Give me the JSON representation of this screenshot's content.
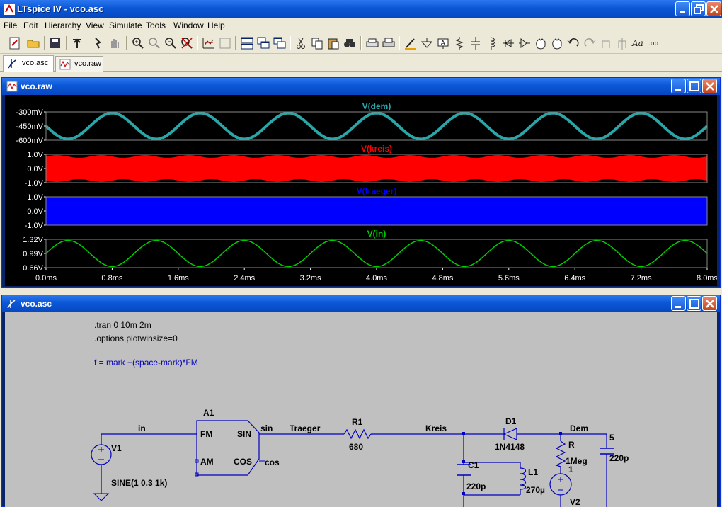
{
  "app": {
    "title": "LTspice IV - vco.asc"
  },
  "menu": [
    "File",
    "Edit",
    "Hierarchy",
    "View",
    "Simulate",
    "Tools",
    "Window",
    "Help"
  ],
  "toolbar_icons": [
    "run-icon",
    "open-icon",
    "save-icon",
    "control-panel-icon",
    "run-sim-icon",
    "halt-icon",
    "zoom-in-icon",
    "zoom-box-icon",
    "zoom-out-icon",
    "zoom-cancel-icon",
    "autoscale-icon",
    "pan-icon",
    "tile-horizontal-icon",
    "cascade-icon",
    "tile-vertical-icon",
    "cut-icon",
    "copy-icon",
    "paste-icon",
    "find-icon",
    "print-setup-icon",
    "print-icon",
    "draw-wire-icon",
    "ground-icon",
    "label-net-icon",
    "resistor-icon",
    "capacitor-icon",
    "inductor-icon",
    "diode-icon",
    "component-icon",
    "move-icon",
    "drag-icon",
    "undo-icon",
    "redo-icon",
    "rotate-icon",
    "mirror-icon",
    "text-icon",
    "spice-directive-icon"
  ],
  "tabs": [
    {
      "label": "vco.asc",
      "active": true
    },
    {
      "label": "vco.raw",
      "active": false
    }
  ],
  "plot_window": {
    "title": "vco.raw",
    "panes": [
      {
        "trace": "V(dem)",
        "color": "#2AA6A8",
        "ticks": [
          "-300mV",
          "-450mV",
          "-600mV"
        ]
      },
      {
        "trace": "V(kreis)",
        "color": "#FF0000",
        "ticks": [
          "1.0V",
          "0.0V",
          "-1.0V"
        ]
      },
      {
        "trace": "V(traeger)",
        "color": "#0000FF",
        "ticks": [
          "1.0V",
          "0.0V",
          "-1.0V"
        ]
      },
      {
        "trace": "V(in)",
        "color": "#00CC00",
        "ticks": [
          "1.32V",
          "0.99V",
          "0.66V"
        ]
      }
    ],
    "x_ticks": [
      "0.0ms",
      "0.8ms",
      "1.6ms",
      "2.4ms",
      "3.2ms",
      "4.0ms",
      "4.8ms",
      "5.6ms",
      "6.4ms",
      "7.2ms",
      "8.0ms"
    ]
  },
  "chart_data": [
    {
      "type": "line",
      "title": "V(dem)",
      "x": [
        0.0,
        0.5,
        1.0,
        1.5,
        2.0,
        2.5,
        3.0,
        3.5,
        4.0,
        4.5,
        5.0,
        5.5,
        6.0,
        6.5,
        7.0,
        7.5,
        8.0
      ],
      "xunit": "ms",
      "y": [
        -450,
        -600,
        -300,
        -600,
        -300,
        -600,
        -300,
        -600,
        -300,
        -600,
        -300,
        -600,
        -300,
        -600,
        -300,
        -600,
        -450
      ],
      "yunit": "mV",
      "ylim": [
        -600,
        -300
      ]
    },
    {
      "type": "line",
      "title": "V(kreis)",
      "ylim": [
        -1.0,
        1.0
      ],
      "yunit": "V",
      "description_values": {
        "amplitude": 0.95
      }
    },
    {
      "type": "line",
      "title": "V(traeger)",
      "ylim": [
        -1.0,
        1.0
      ],
      "yunit": "V",
      "description_values": {
        "amplitude": 1.0
      }
    },
    {
      "type": "line",
      "title": "V(in)",
      "x": [
        0.0,
        0.5,
        1.0,
        1.5,
        2.0,
        2.5,
        3.0,
        3.5,
        4.0,
        4.5,
        5.0,
        5.5,
        6.0,
        6.5,
        7.0,
        7.5,
        8.0
      ],
      "xunit": "ms",
      "y": [
        0.99,
        1.29,
        0.69,
        1.29,
        0.69,
        1.29,
        0.69,
        1.29,
        0.69,
        1.29,
        0.69,
        1.29,
        0.69,
        1.29,
        0.69,
        1.29,
        0.99
      ],
      "yunit": "V",
      "ylim": [
        0.66,
        1.32
      ]
    }
  ],
  "schematic_window": {
    "title": "vco.asc",
    "directives": [
      ".tran 0 10m 2m",
      ".options plotwinsize=0"
    ],
    "comment": "f = mark +(space-mark)*FM",
    "labels": {
      "A1": "A1",
      "FM": "FM",
      "AM": "AM",
      "SIN": "SIN",
      "COS": "COS",
      "in": "in",
      "sin": "sin",
      "cos": "cos",
      "traeger": "Traeger",
      "kreis": "Kreis",
      "dem": "Dem",
      "R1": "R1",
      "R1val": "680",
      "V1": "V1",
      "V1val": "SINE(1 0.3 1k)",
      "D1": "D1",
      "D1val": "1N4148",
      "C1": "C1",
      "C1val": "220p",
      "L1": "L1",
      "L1val": "270µ",
      "R": "R",
      "Rval": "1Meg",
      "Rnum": "1",
      "V2": "V2",
      "C5": "5",
      "C5val": "220p"
    }
  }
}
